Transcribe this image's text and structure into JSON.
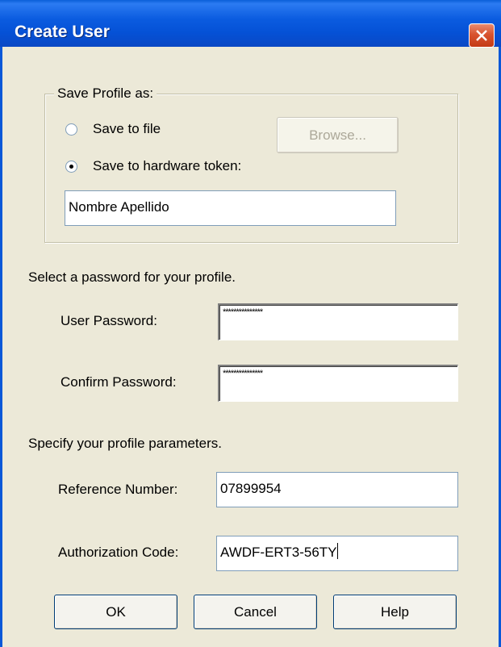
{
  "window": {
    "title": "Create User"
  },
  "save_profile": {
    "legend": "Save Profile as:",
    "options": [
      {
        "label": "Save to file",
        "checked": false
      },
      {
        "label": "Save to hardware token:",
        "checked": true
      }
    ],
    "browse_label": "Browse...",
    "token_name": "Nombre Apellido"
  },
  "password_section": {
    "heading": "Select a password for your profile.",
    "user_password_label": "User Password:",
    "user_password_value": "***************",
    "confirm_password_label": "Confirm Password:",
    "confirm_password_value": "***************"
  },
  "profile_params": {
    "heading": "Specify your profile parameters.",
    "reference_label": "Reference Number:",
    "reference_value": "07899954",
    "auth_label": "Authorization Code:",
    "auth_value": "AWDF-ERT3-56TY"
  },
  "buttons": {
    "ok": "OK",
    "cancel": "Cancel",
    "help": "Help"
  }
}
